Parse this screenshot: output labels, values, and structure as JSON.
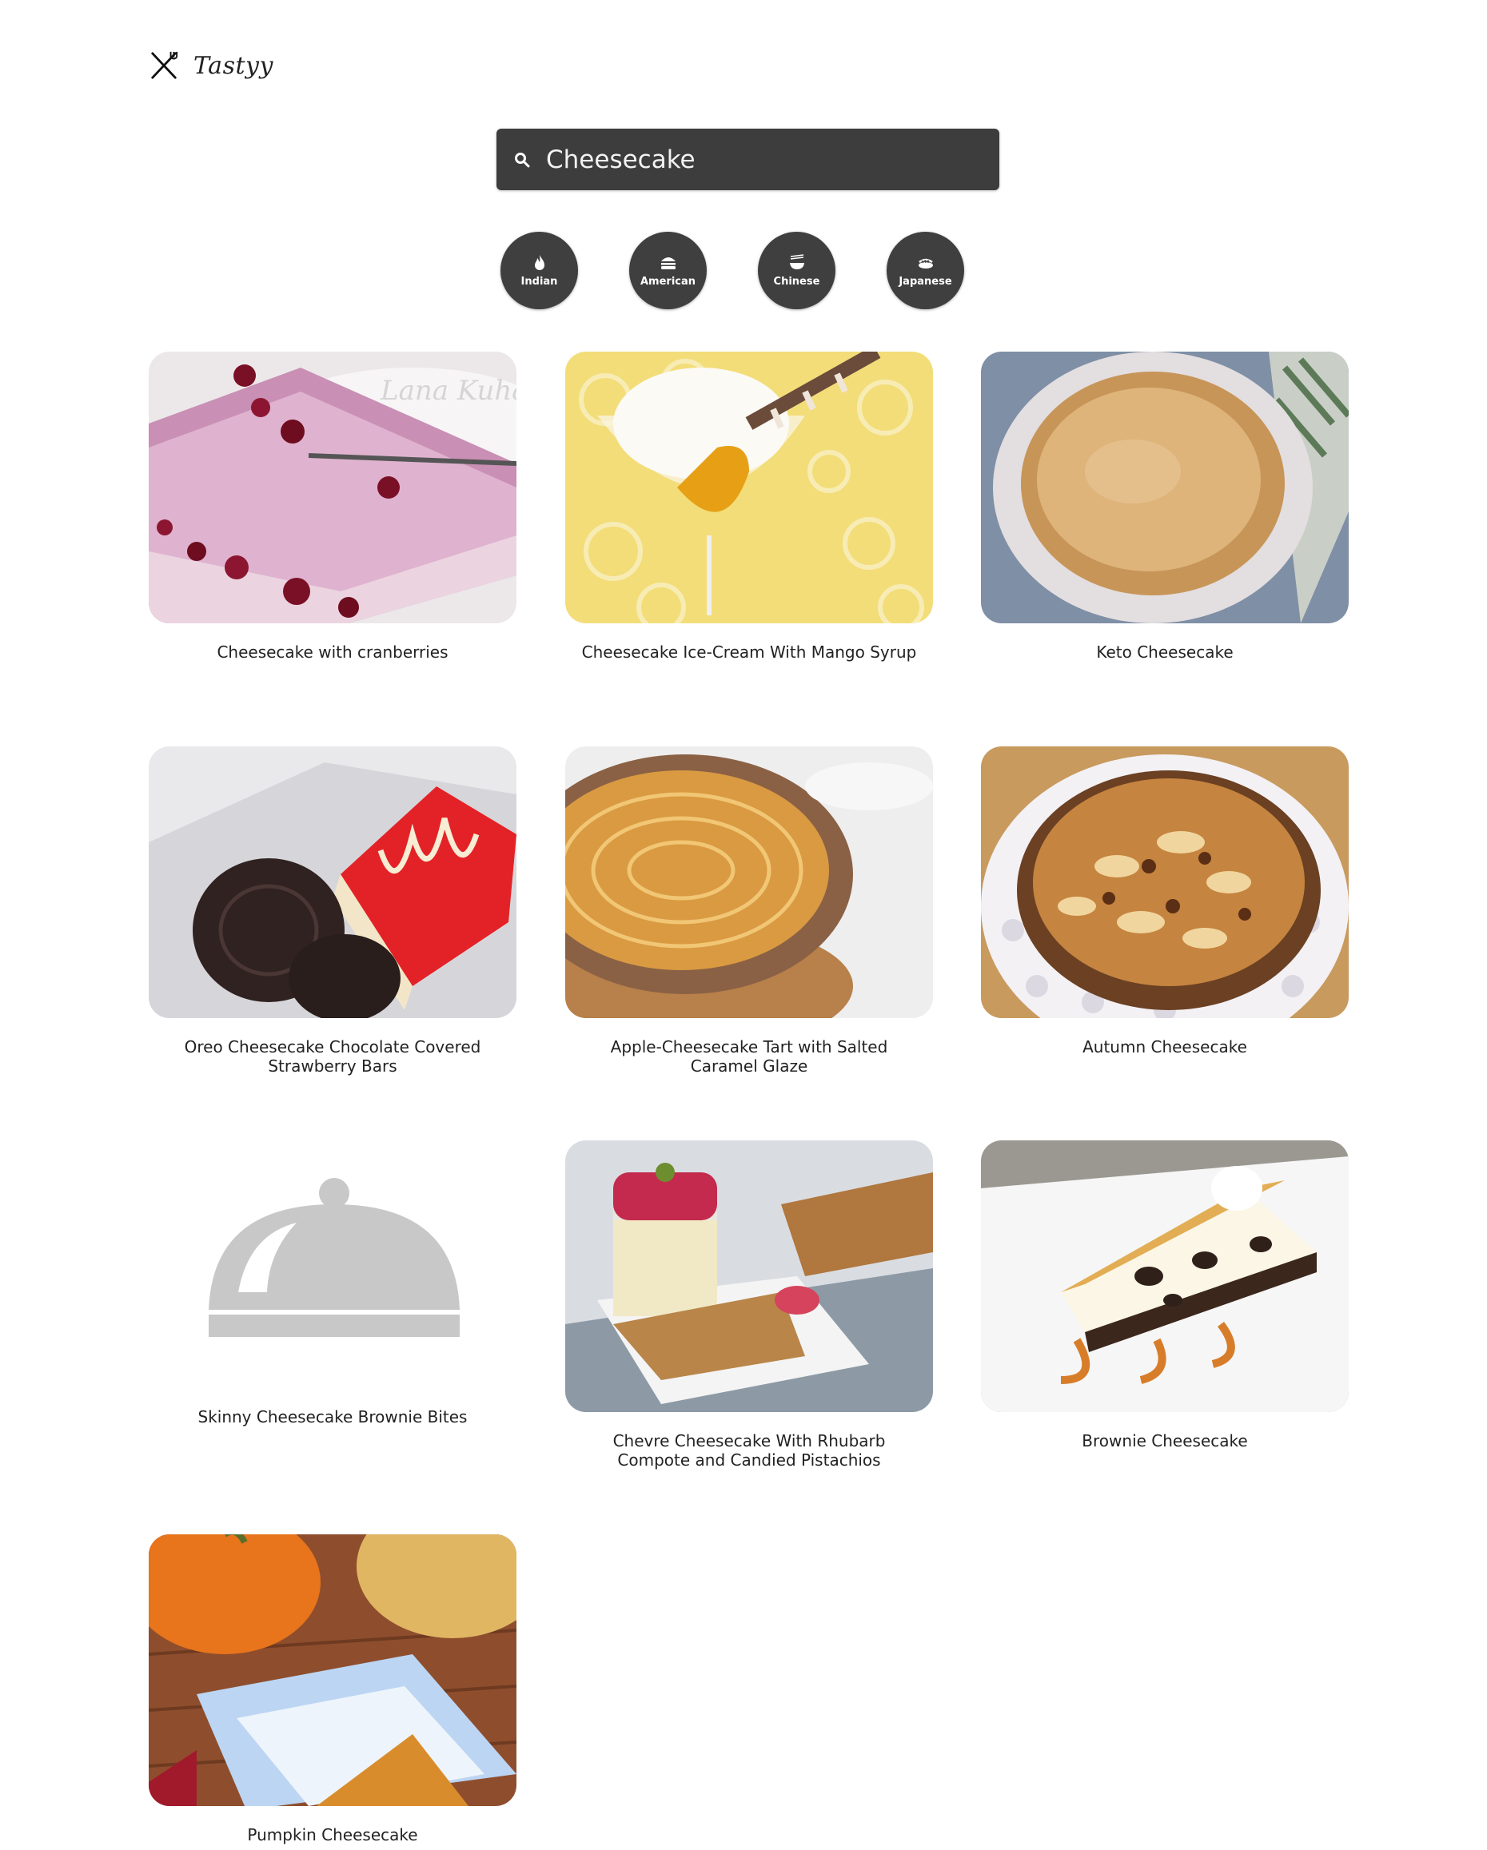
{
  "brand": {
    "name": "Tastyy",
    "logo_icon": "fork-knife-icon"
  },
  "search": {
    "value": "Cheesecake",
    "icon": "search-icon"
  },
  "cuisines": [
    {
      "label": "Indian",
      "icon": "flame-icon"
    },
    {
      "label": "American",
      "icon": "burger-icon"
    },
    {
      "label": "Chinese",
      "icon": "noodles-icon"
    },
    {
      "label": "Japanese",
      "icon": "sushi-icon"
    }
  ],
  "recipes": [
    {
      "title": "Cheesecake with cranberries"
    },
    {
      "title": "Cheesecake Ice-Cream With Mango Syrup"
    },
    {
      "title": "Keto Cheesecake"
    },
    {
      "title": "Oreo Cheesecake Chocolate Covered Strawberry Bars"
    },
    {
      "title": "Apple-Cheesecake Tart with Salted Caramel Glaze"
    },
    {
      "title": "Autumn Cheesecake"
    },
    {
      "title": "Skinny Cheesecake Brownie Bites"
    },
    {
      "title": "Chevre Cheesecake With Rhubarb Compote and Candied Pistachios"
    },
    {
      "title": "Brownie Cheesecake"
    },
    {
      "title": "Pumpkin Cheesecake"
    }
  ],
  "watermark": "Lana Kuhanets",
  "colors": {
    "dark": "#3d3d3d",
    "text": "#222222",
    "placeholder": "#cccccc"
  }
}
